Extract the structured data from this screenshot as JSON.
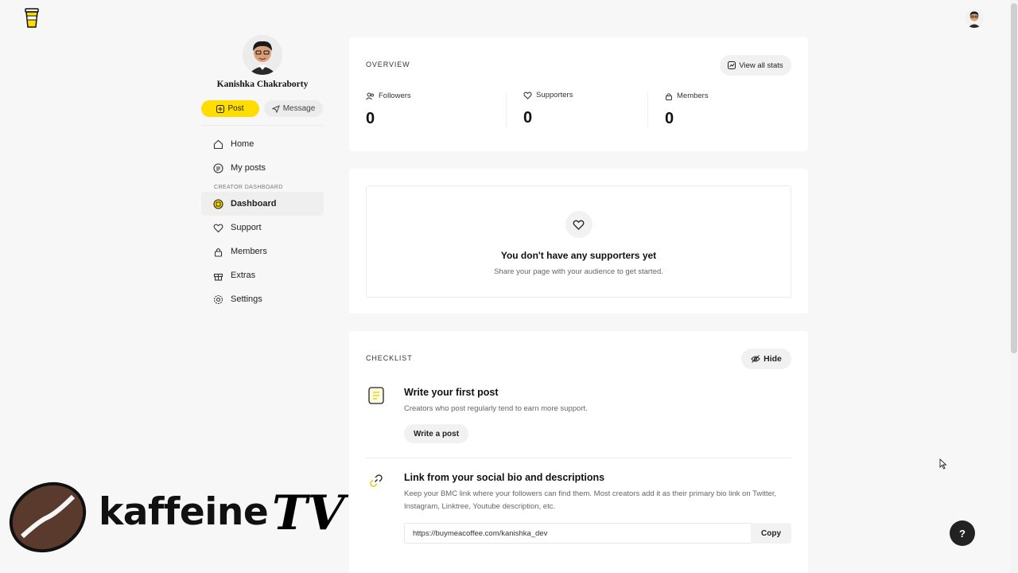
{
  "profile": {
    "name": "Kanishka Chakraborty",
    "post_label": "Post",
    "message_label": "Message"
  },
  "nav": {
    "items": [
      {
        "label": "Home",
        "icon": "home-icon"
      },
      {
        "label": "My posts",
        "icon": "posts-icon"
      }
    ],
    "section_label": "CREATOR DASHBOARD",
    "creator_items": [
      {
        "label": "Dashboard",
        "icon": "dashboard-icon",
        "active": true
      },
      {
        "label": "Support",
        "icon": "heart-icon"
      },
      {
        "label": "Members",
        "icon": "lock-icon"
      },
      {
        "label": "Extras",
        "icon": "gift-icon"
      },
      {
        "label": "Settings",
        "icon": "gear-icon"
      }
    ]
  },
  "overview": {
    "title": "OVERVIEW",
    "view_all_label": "View all stats",
    "stats": [
      {
        "label": "Followers",
        "value": "0"
      },
      {
        "label": "Supporters",
        "value": "0"
      },
      {
        "label": "Members",
        "value": "0"
      }
    ]
  },
  "supporters_empty": {
    "title": "You don't have any supporters yet",
    "subtitle": "Share your page with your audience to get started."
  },
  "checklist": {
    "title": "CHECKLIST",
    "hide_label": "Hide",
    "items": [
      {
        "title": "Write your first post",
        "description": "Creators who post regularly tend to earn more support.",
        "button": "Write a post"
      },
      {
        "title": "Link from your social bio and descriptions",
        "description": "Keep your BMC link where your followers can find them. Most creators add it as their primary bio link on Twitter, Instagram, Linktree, Youtube description, etc.",
        "link": "https://buymeacoffee.com/kanishka_dev",
        "copy_label": "Copy"
      }
    ]
  },
  "help_label": "?",
  "watermark": {
    "text": "kaffeine",
    "tv": "TV"
  },
  "colors": {
    "accent": "#ffdd00",
    "background": "#f7f7f7",
    "card": "#ffffff"
  }
}
